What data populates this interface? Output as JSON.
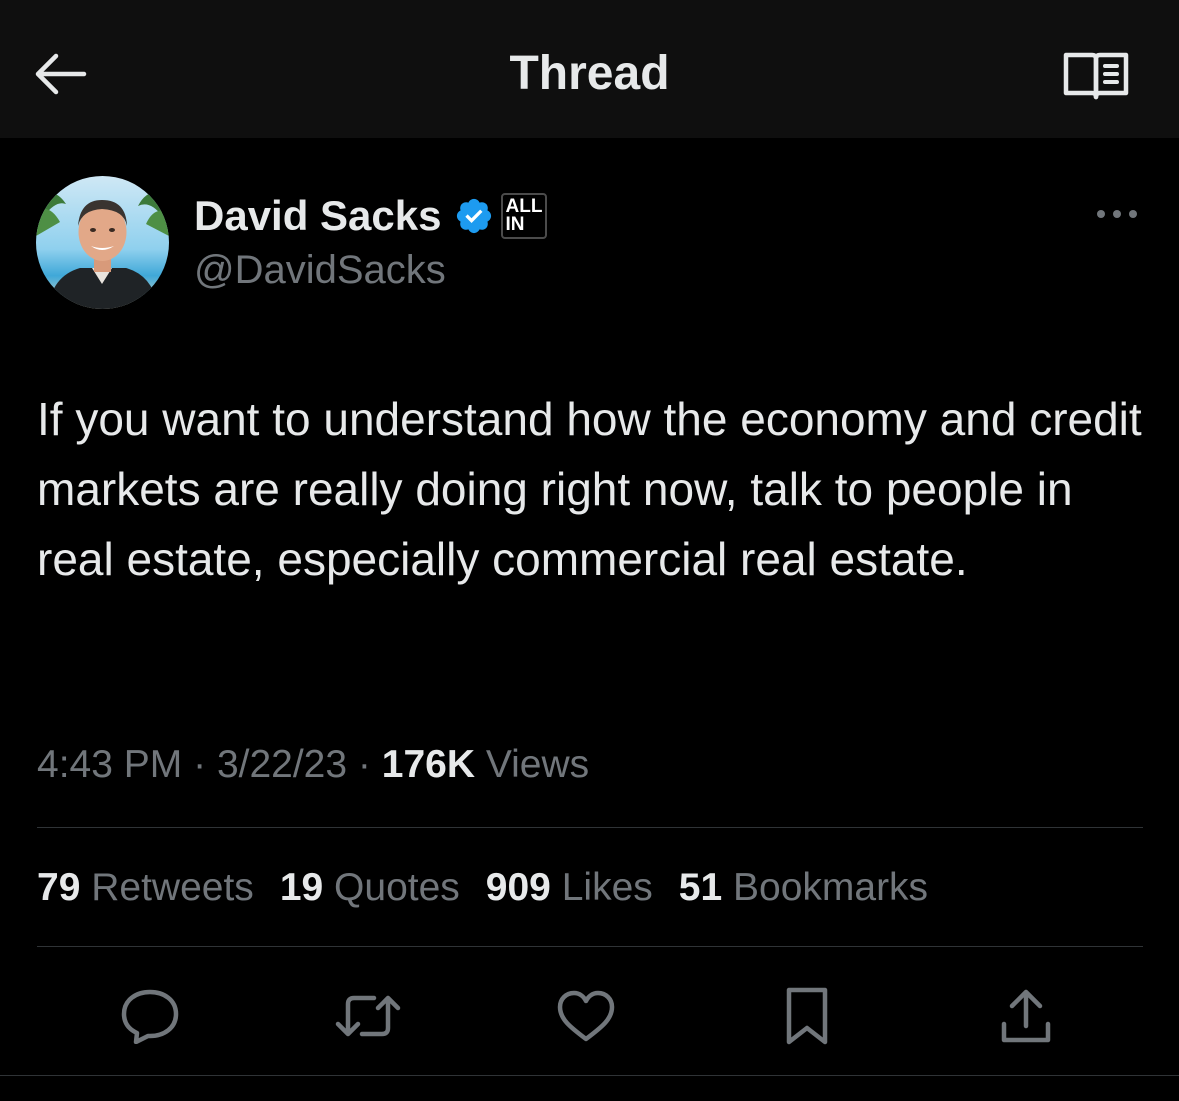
{
  "header": {
    "title": "Thread",
    "back_icon": "arrow-left-icon",
    "reader_icon": "open-book-icon"
  },
  "tweet": {
    "author_name": "David Sacks",
    "handle": "@DavidSacks",
    "affiliate_badge": {
      "line1": "ALL",
      "line2": "IN"
    },
    "verified_color": "#1d9bf0",
    "text": "If you want to understand how the economy and credit markets are really doing right now, talk to people in real estate, especially commercial real estate.",
    "time": "4:43 PM",
    "separator": "·",
    "date": "3/22/23",
    "views_count": "176K",
    "views_label": "Views"
  },
  "stats": {
    "retweets": {
      "count": "79",
      "label": "Retweets"
    },
    "quotes": {
      "count": "19",
      "label": "Quotes"
    },
    "likes": {
      "count": "909",
      "label": "Likes"
    },
    "bookmarks": {
      "count": "51",
      "label": "Bookmarks"
    }
  },
  "actions": [
    {
      "icon": "reply-icon"
    },
    {
      "icon": "retweet-icon"
    },
    {
      "icon": "like-icon"
    },
    {
      "icon": "bookmark-icon"
    },
    {
      "icon": "share-icon"
    }
  ],
  "colors": {
    "background": "#000000",
    "header_background": "#0f0f0f",
    "primary_text": "#e7e9ea",
    "secondary_text": "#71767b",
    "divider": "#2f3336",
    "verified": "#1d9bf0"
  }
}
